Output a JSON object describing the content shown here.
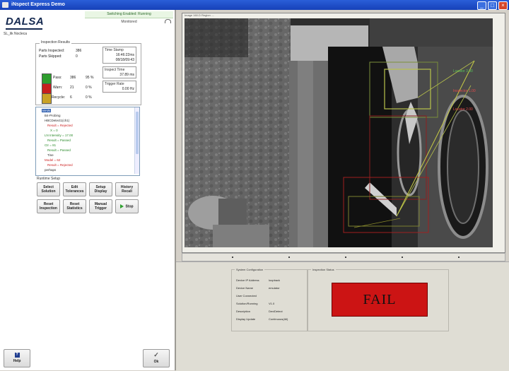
{
  "window": {
    "title": "iNspect Express Demo",
    "minimize": "_",
    "maximize": "□",
    "close": "×"
  },
  "header": {
    "logo": "DALSA",
    "system_name": "SL_lik Nocleca",
    "status": "Switching Enabled: Running",
    "status2": "Monitored"
  },
  "results": {
    "group_title": "Inspection Results",
    "parts_inspected_label": "Parts Inspected:",
    "parts_inspected_value": "386",
    "parts_skipped_label": "Parts Skipped:",
    "parts_skipped_value": "0",
    "rows": [
      {
        "label": "Pass:",
        "count": "386",
        "pct": "95 %",
        "color": "#2e9e2e"
      },
      {
        "label": "Warn:",
        "count": "21",
        "pct": "0 %",
        "color": "#c71f1f"
      },
      {
        "label": "Recycle:",
        "count": "6",
        "pct": "0 %",
        "color": "#c9a227"
      }
    ],
    "info": [
      {
        "h": "Time Stamp",
        "v": "16:46:22ms"
      },
      {
        "h": "",
        "v": "08/18/09:43"
      },
      {
        "h": "Inspect Time",
        "v": "37.89 ms"
      },
      {
        "h": "Trigger Rate",
        "v": "0.00 Hz"
      }
    ]
  },
  "tree": {
    "items": [
      {
        "text": "MAIN",
        "color": "#fff",
        "bg": "#2f5fb0"
      },
      {
        "text": "B4-Probing",
        "color": "#2a2a2a",
        "bg": ""
      },
      {
        "text": "HBCDetect1(ch1)",
        "color": "#2a2a2a",
        "bg": ""
      },
      {
        "text": "Result = Rejected",
        "color": "#cc1f1f",
        "bg": ""
      },
      {
        "text": "X = 0",
        "color": "#2a8a2a",
        "bg": ""
      },
      {
        "text": "LN Intensity = 17.00",
        "color": "#2a8a2a",
        "bg": ""
      },
      {
        "text": "Result = Passed",
        "color": "#2a8a2a",
        "bg": ""
      },
      {
        "text": "Ctr = 81",
        "color": "#2a8a2a",
        "bg": ""
      },
      {
        "text": "Result = Passed",
        "color": "#2a8a2a",
        "bg": ""
      },
      {
        "text": "Tine",
        "color": "#2a2a2a",
        "bg": ""
      },
      {
        "text": "Model = 62",
        "color": "#cc1f1f",
        "bg": ""
      },
      {
        "text": "Result = Rejected",
        "color": "#cc1f1f",
        "bg": ""
      },
      {
        "text": "perhaps",
        "color": "#2a2a2a",
        "bg": ""
      }
    ]
  },
  "runtime": {
    "group_title": "Runtime Setup",
    "buttons": [
      "Select Solution",
      "Edit Tolerances",
      "Setup Display",
      "History Recall",
      "Reset Inspection",
      "Reset Statistics",
      "Manual Trigger",
      "Stop"
    ]
  },
  "footer": {
    "help": "Help",
    "ok": "Ok",
    "ok_icon": "✓"
  },
  "viewer": {
    "title": "Image 160.D Region ....",
    "overlay_labels": [
      "Locator 3.00",
      "Inspector 1.00",
      "Locator 2.00"
    ]
  },
  "system_config": {
    "group_title": "System Configuration",
    "rows": [
      {
        "k": "Device IP Address",
        "v": "loopback"
      },
      {
        "k": "Device Name",
        "v": "emulator"
      },
      {
        "k": "User Connected",
        "v": ""
      },
      {
        "k": "Solution/Running",
        "v": "V1.0"
      },
      {
        "k": "Description",
        "v": "DeviDetect"
      },
      {
        "k": "Display Update",
        "v": "Continuous(All)"
      }
    ]
  },
  "inspection_status": {
    "group_title": "Inspection Status",
    "result": "FAIL"
  }
}
